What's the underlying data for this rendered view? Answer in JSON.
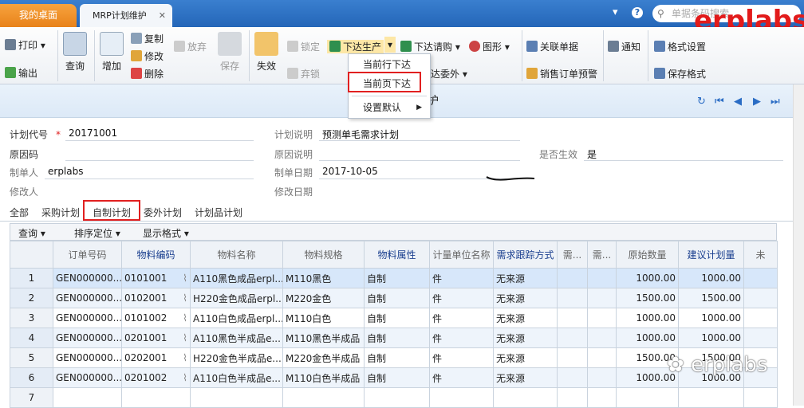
{
  "tabs": {
    "desktop": "我的桌面",
    "current": "MRP计划维护",
    "close": "✕"
  },
  "topbar": {
    "dropdown": "▾",
    "help": "?",
    "search_placeholder": "单据条码搜索",
    "logo": "erplabs"
  },
  "ribbon": {
    "print": "打印",
    "output": "输出",
    "query": "查询",
    "add": "增加",
    "copy": "复制",
    "modify": "修改",
    "delete": "删除",
    "abandon": "放弃",
    "save": "保存",
    "invalid": "失效",
    "lock": "锁定",
    "unlock": "弃锁",
    "issue_production": "下达生产",
    "issue_purchase": "下达请购",
    "outsource": "达委外",
    "chart": "图形",
    "linked_docs": "关联单据",
    "sales_order_alert": "销售订单预警",
    "notice": "通知",
    "format_settings": "格式设置",
    "save_format": "保存格式"
  },
  "dropdown_menu": {
    "items": [
      "当前行下达",
      "当前页下达",
      "设置默认"
    ]
  },
  "title": {
    "text": "护"
  },
  "form": {
    "plan_code_label": "计划代号",
    "plan_code": "20171001",
    "plan_desc_label": "计划说明",
    "plan_desc": "预测单毛需求计划",
    "reason_code_label": "原因码",
    "reason_desc_label": "原因说明",
    "effective_label": "是否生效",
    "effective": "是",
    "creator_label": "制单人",
    "creator": "erplabs",
    "create_date_label": "制单日期",
    "create_date": "2017-10-05",
    "modifier_label": "修改人",
    "modify_date_label": "修改日期"
  },
  "subtabs": [
    "全部",
    "采购计划",
    "自制计划",
    "委外计划",
    "计划品计划"
  ],
  "gridtools": {
    "query": "查询",
    "sort": "排序定位",
    "display": "显示格式"
  },
  "table": {
    "columns": [
      "",
      "订单号码",
      "物料编码",
      "物料名称",
      "物料规格",
      "物料属性",
      "计量单位名称",
      "需求跟踪方式",
      "需...",
      "需...",
      "原始数量",
      "建议计划量",
      "未"
    ],
    "rows": [
      {
        "n": "1",
        "order": "GEN000000...",
        "code": "0101001",
        "name": "A110黑色成品erpl...",
        "spec": "M110黑色",
        "attr": "自制",
        "unit": "件",
        "track": "无来源",
        "orig": "1000.00",
        "sugg": "1000.00"
      },
      {
        "n": "2",
        "order": "GEN000000...",
        "code": "0102001",
        "name": "H220金色成品erpl...",
        "spec": "M220金色",
        "attr": "自制",
        "unit": "件",
        "track": "无来源",
        "orig": "1500.00",
        "sugg": "1500.00"
      },
      {
        "n": "3",
        "order": "GEN000000...",
        "code": "0101002",
        "name": "A110白色成品erpl...",
        "spec": "M110白色",
        "attr": "自制",
        "unit": "件",
        "track": "无来源",
        "orig": "1000.00",
        "sugg": "1000.00"
      },
      {
        "n": "4",
        "order": "GEN000000...",
        "code": "0201001",
        "name": "A110黑色半成品e...",
        "spec": "M110黑色半成品",
        "attr": "自制",
        "unit": "件",
        "track": "无来源",
        "orig": "1000.00",
        "sugg": "1000.00"
      },
      {
        "n": "5",
        "order": "GEN000000...",
        "code": "0202001",
        "name": "H220金色半成品e...",
        "spec": "M220金色半成品",
        "attr": "自制",
        "unit": "件",
        "track": "无来源",
        "orig": "1500.00",
        "sugg": "1500.00"
      },
      {
        "n": "6",
        "order": "GEN000000...",
        "code": "0201002",
        "name": "A110白色半成品e...",
        "spec": "M110白色半成品",
        "attr": "自制",
        "unit": "件",
        "track": "无来源",
        "orig": "1000.00",
        "sugg": "1000.00"
      },
      {
        "n": "7",
        "order": "",
        "code": "",
        "name": "",
        "spec": "",
        "attr": "",
        "unit": "",
        "track": "",
        "orig": "",
        "sugg": ""
      }
    ]
  },
  "watermark": "erplabs"
}
